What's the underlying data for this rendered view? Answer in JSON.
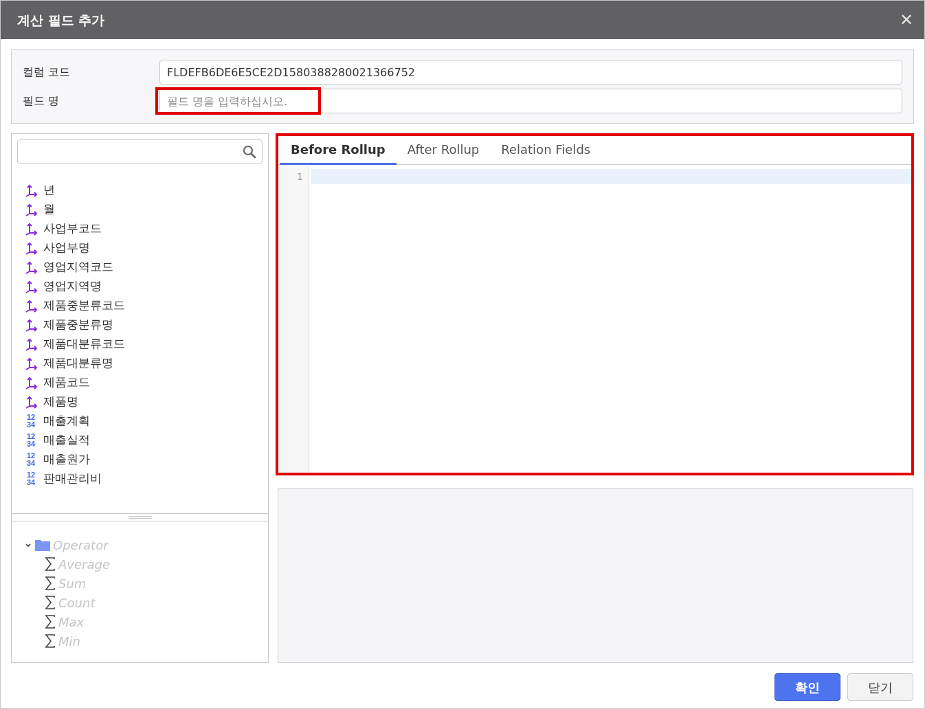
{
  "window": {
    "title": "계산 필드 추가",
    "close": "✕"
  },
  "form": {
    "fields": [
      {
        "label": "컬럼 코드",
        "value": "FLDEFB6DE6E5CE2D1580388280021366752",
        "highlighted": false
      },
      {
        "label": "필드 명",
        "placeholder": "필드 명을 입력하십시오.",
        "highlighted": true
      }
    ]
  },
  "field_list": {
    "items": [
      {
        "kind": "dimension",
        "label": "년"
      },
      {
        "kind": "dimension",
        "label": "월"
      },
      {
        "kind": "dimension",
        "label": "사업부코드"
      },
      {
        "kind": "dimension",
        "label": "사업부명"
      },
      {
        "kind": "dimension",
        "label": "영업지역코드"
      },
      {
        "kind": "dimension",
        "label": "영업지역명"
      },
      {
        "kind": "dimension",
        "label": "제품중분류코드"
      },
      {
        "kind": "dimension",
        "label": "제품중분류명"
      },
      {
        "kind": "dimension",
        "label": "제품대분류코드"
      },
      {
        "kind": "dimension",
        "label": "제품대분류명"
      },
      {
        "kind": "dimension",
        "label": "제품코드"
      },
      {
        "kind": "dimension",
        "label": "제품명"
      },
      {
        "kind": "measure",
        "icon_digits": [
          "12",
          "34"
        ],
        "label": "매출계획"
      },
      {
        "kind": "measure",
        "icon_digits": [
          "12",
          "34"
        ],
        "label": "매출실적"
      },
      {
        "kind": "measure",
        "icon_digits": [
          "12",
          "34"
        ],
        "label": "매출원가"
      },
      {
        "kind": "measure",
        "icon_digits": [
          "12",
          "34"
        ],
        "label": "판매관리비"
      }
    ]
  },
  "operator_tree": {
    "label": "Operator",
    "expanded": true,
    "disabled": true,
    "children": [
      {
        "label": "Average"
      },
      {
        "label": "Sum"
      },
      {
        "label": "Count"
      },
      {
        "label": "Max"
      },
      {
        "label": "Min"
      }
    ]
  },
  "editor": {
    "highlighted": true,
    "tabs": [
      {
        "label": "Before Rollup",
        "selected": true
      },
      {
        "label": "After Rollup",
        "selected": false
      },
      {
        "label": "Relation Fields",
        "selected": false
      }
    ],
    "line_numbers": [
      "1"
    ]
  },
  "buttons": [
    {
      "label": "확인",
      "kind": "primary"
    },
    {
      "label": "닫기",
      "kind": "secondary"
    }
  ]
}
